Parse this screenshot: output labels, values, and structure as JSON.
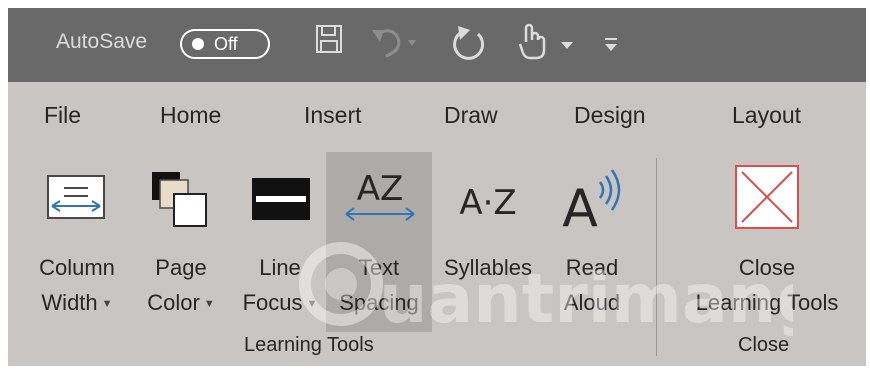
{
  "qat": {
    "autosave_label": "AutoSave",
    "toggle_state": "Off"
  },
  "menu": {
    "tabs": [
      "File",
      "Home",
      "Insert",
      "Draw",
      "Design",
      "Layout"
    ]
  },
  "ribbon": {
    "buttons": [
      {
        "line1": "Column",
        "line2": "Width"
      },
      {
        "line1": "Page",
        "line2": "Color"
      },
      {
        "line1": "Line",
        "line2": "Focus"
      },
      {
        "line1": "Text",
        "line2": "Spacing"
      },
      {
        "line1": "Syllables",
        "line2": ""
      },
      {
        "line1": "Read",
        "line2": "Aloud"
      },
      {
        "line1": "Close",
        "line2": "Learning Tools"
      }
    ],
    "groups": [
      "Learning Tools",
      "Close"
    ],
    "icon_text": {
      "text_spacing": "AZ",
      "syllables": "A·Z",
      "read_aloud": "A"
    }
  },
  "watermark": {
    "text": "uantrimang"
  },
  "colors": {
    "qat_bg": "#696969",
    "ribbon_bg": "#c9c5c3",
    "selected_bg": "#aeaaa8",
    "accent_blue": "#2e75b6",
    "close_red": "#e04b4b"
  }
}
